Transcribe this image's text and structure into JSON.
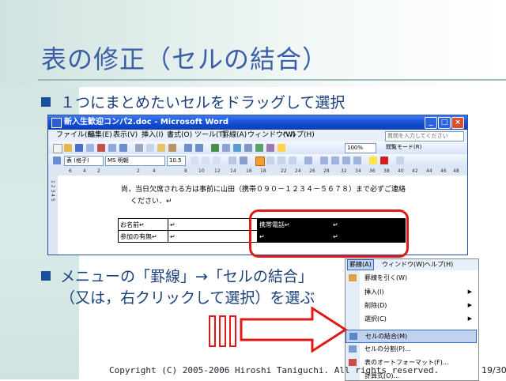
{
  "slide": {
    "title": "表の修正（セルの結合）",
    "bullet1": "１つにまとめたいセルをドラッグして選択",
    "bullet2_line1": "メニューの「罫線」→「セルの結合」",
    "bullet2_line2": "（又は，右クリックして選択）を選ぶ",
    "footer": "Copyright (C) 2005-2006 Hiroshi Taniguchi. All rights reserved.",
    "page": "19/30"
  },
  "colors": {
    "title": "#3a5fa8",
    "bullet": "#1a4f9c",
    "highlight_red": "#e01818",
    "xp_blue": "#1550d6"
  },
  "word": {
    "window_title": "新入生歓迎コンパ2.doc - Microsoft Word",
    "window_buttons": [
      "_",
      "□",
      "×"
    ],
    "menus": [
      "ファイル(F)",
      "編集(E)",
      "表示(V)",
      "挿入(I)",
      "書式(O)",
      "ツール(T)",
      "罫線(A)",
      "ウィンドウ(W)",
      "ヘルプ(H)"
    ],
    "help_placeholder": "質問を入力してください",
    "zoom": "100%",
    "reading_mode": "閲覧モード(R)",
    "style": "表 (格子)",
    "font": "MS 明朝",
    "font_size": "10.5",
    "ruler_ticks": [
      "6",
      "4",
      "2",
      "2",
      "4",
      "8",
      "10",
      "12",
      "14",
      "16",
      "18",
      "22",
      "24",
      "26",
      "28",
      "32",
      "34",
      "36",
      "38",
      "40",
      "42",
      "44",
      "46",
      "48"
    ],
    "vruler": "1 2 3 4 5",
    "doc_line1": "尚，当日欠席される方は事前に山田（携帯０９０－１２３４－５６７８）まで必ずご連絡",
    "doc_line2": "ください．↵",
    "table": [
      [
        "お名前↵",
        "↵",
        "携帯電話↵",
        "↵"
      ],
      [
        "参加の有無↵",
        "↵",
        "↵",
        "↵"
      ]
    ]
  },
  "menu": {
    "bar": [
      "罫線(A)",
      "ウィンドウ(W)",
      "ヘルプ(H)"
    ],
    "items": [
      {
        "label": "罫線を引く(W)",
        "arrow": false
      },
      {
        "label": "挿入(I)",
        "arrow": true
      },
      {
        "label": "削除(D)",
        "arrow": true
      },
      {
        "label": "選択(C)",
        "arrow": true
      },
      {
        "label": "セルの結合(M)",
        "arrow": false,
        "highlight": true
      },
      {
        "label": "セルの分割(P)...",
        "arrow": false
      },
      {
        "label": "表のオートフォーマット(F)...",
        "arrow": false
      },
      {
        "label": "計算式(O)...",
        "arrow": false
      }
    ]
  }
}
